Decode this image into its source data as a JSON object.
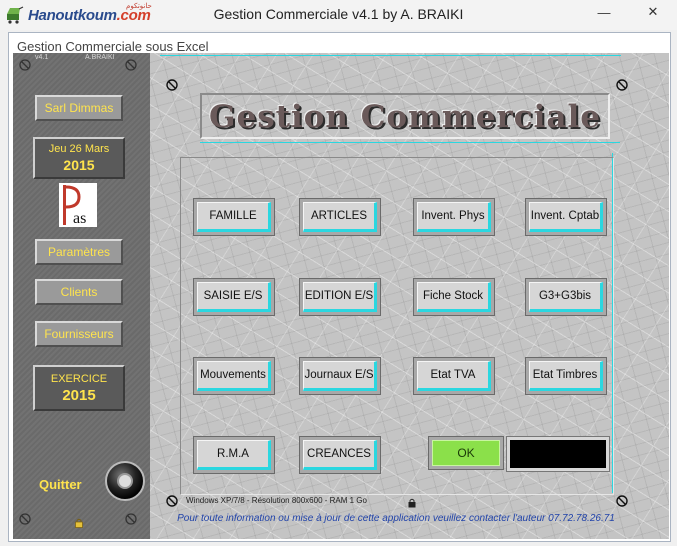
{
  "window": {
    "title": "Gestion Commerciale v4.1  by A.  BRAIKI",
    "minimize_glyph": "—",
    "close_glyph": "✕",
    "brand_main": "Hanoutkoum",
    "brand_suffix": ".com",
    "brand_arabic": "حانوتكوم"
  },
  "inner_window": {
    "title": "Gestion Commerciale sous Excel"
  },
  "sidebar": {
    "version": "v4.1",
    "author": "A.BRAIKI",
    "company": "Sarl Dimmas",
    "date_line": "Jeu 26 Mars",
    "date_year": "2015",
    "logo_text": "as",
    "buttons": [
      "Paramètres",
      "Clients",
      "Fournisseurs"
    ],
    "exercice_label": "EXERCICE",
    "exercice_year": "2015",
    "quit_label": "Quitter"
  },
  "main": {
    "title": "Gestion Commerciale",
    "grid_buttons": [
      [
        "FAMILLE",
        "ARTICLES",
        "Invent. Phys",
        "Invent. Cptab"
      ],
      [
        "SAISIE E/S",
        "EDITION E/S",
        "Fiche Stock",
        "G3+G3bis"
      ],
      [
        "Mouvements",
        "Journaux E/S",
        "Etat TVA",
        "Etat Timbres"
      ],
      [
        "R.M.A",
        "CREANCES"
      ]
    ],
    "ok_label": "OK",
    "system_info": "Windows XP/7/8 - Résolution 800x600 - RAM 1 Go",
    "contact": "Pour toute information ou mise à jour de cette application veuillez contacter l'auteur 07.72.78.26.71"
  },
  "colors": {
    "accent_cyan": "#2ad7e0",
    "label_yellow": "#ffe44d",
    "ok_green": "#8be04a",
    "sidebar_gray": "#6e6e6e"
  }
}
